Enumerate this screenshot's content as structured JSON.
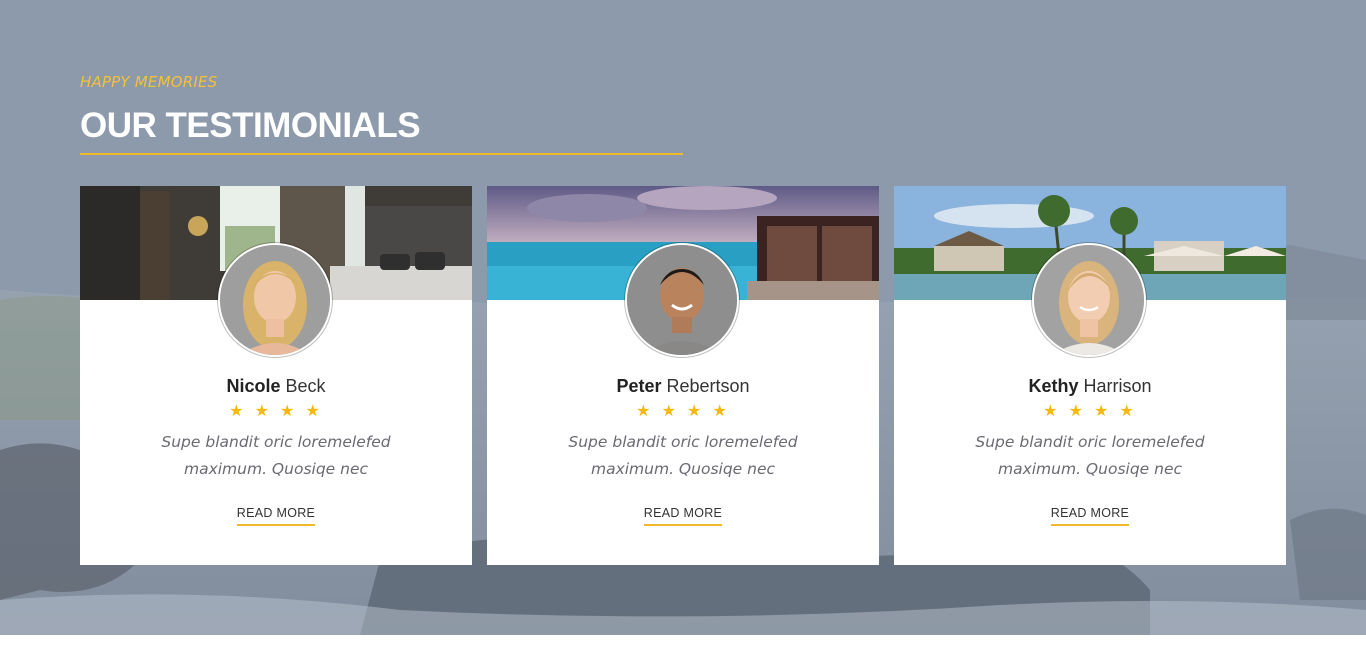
{
  "section": {
    "eyebrow": "HAPPY MEMORIES",
    "title": "OUR TESTIMONIALS"
  },
  "colors": {
    "accent": "#f2b92c",
    "star": "#f5b80e",
    "background_overlay": "#8c9bab"
  },
  "testimonials": [
    {
      "first_name": "Nicole",
      "last_name": "Beck",
      "stars": "★ ★ ★ ★",
      "rating": 4,
      "quote": "Supe blandit oric loremelefed maximum. Quosiqe nec",
      "read_more": "READ MORE",
      "photo_icon": "hotel-room-photo",
      "avatar_icon": "woman-avatar"
    },
    {
      "first_name": "Peter",
      "last_name": "Rebertson",
      "stars": "★ ★ ★ ★",
      "rating": 4,
      "quote": "Supe blandit oric loremelefed maximum. Quosiqe nec",
      "read_more": "READ MORE",
      "photo_icon": "beach-cabana-photo",
      "avatar_icon": "man-avatar"
    },
    {
      "first_name": "Kethy",
      "last_name": "Harrison",
      "stars": "★ ★ ★ ★",
      "rating": 4,
      "quote": "Supe blandit oric loremelefed maximum. Quosiqe nec",
      "read_more": "READ MORE",
      "photo_icon": "resort-pool-photo",
      "avatar_icon": "woman-avatar"
    }
  ]
}
